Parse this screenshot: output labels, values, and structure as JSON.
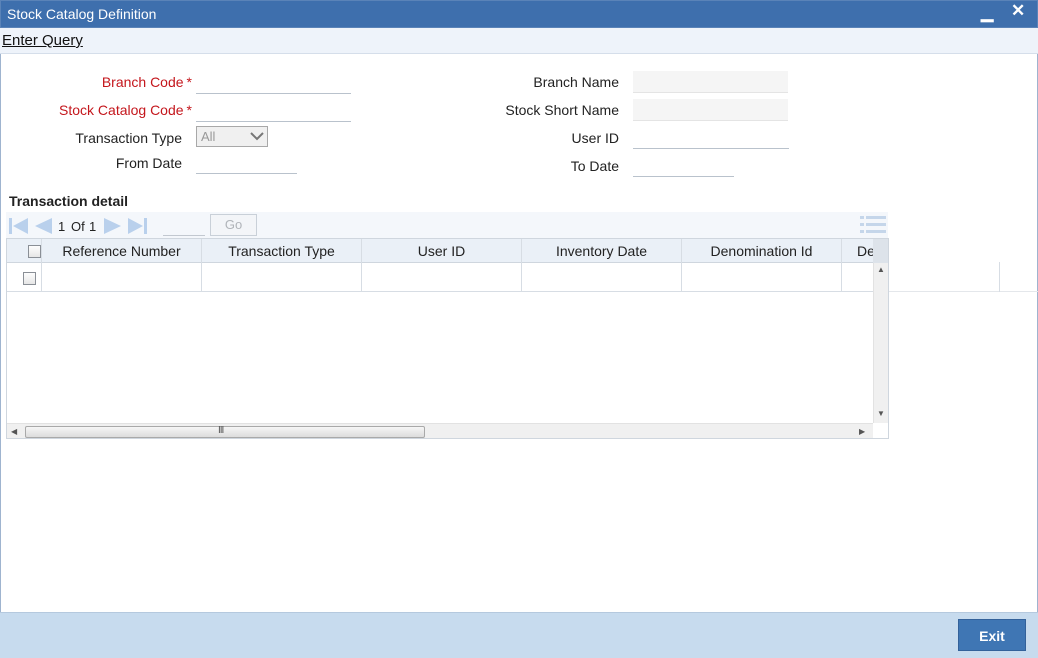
{
  "window": {
    "title": "Stock Catalog Definition",
    "minimize_glyph": "▁",
    "close_glyph": "✕"
  },
  "menu": {
    "enter_query": "Enter Query"
  },
  "form": {
    "branch_code_label": "Branch Code",
    "stock_catalog_code_label": "Stock Catalog Code",
    "transaction_type_label": "Transaction Type",
    "transaction_type_value": "All",
    "from_date_label": "From Date",
    "branch_name_label": "Branch Name",
    "stock_short_name_label": "Stock Short Name",
    "user_id_label": "User ID",
    "to_date_label": "To Date",
    "required_mark": "*"
  },
  "transaction_detail": {
    "title": "Transaction detail",
    "pager": {
      "current": "1",
      "of_label": "Of",
      "total": "1",
      "go_label": "Go"
    },
    "columns": [
      "Reference Number",
      "Transaction Type",
      "User ID",
      "Inventory Date",
      "Denomination Id",
      "De"
    ],
    "scroll_grip": "III"
  },
  "footer": {
    "exit_label": "Exit"
  },
  "colors": {
    "title_bar": "#3e6fad",
    "required_label": "#c4161c",
    "footer": "#c7dbee",
    "exit_button": "#3f76b4"
  },
  "icons": [
    "minimize-icon",
    "close-icon",
    "first-page-icon",
    "previous-page-icon",
    "next-page-icon",
    "last-page-icon",
    "column-list-icon",
    "checkbox"
  ]
}
